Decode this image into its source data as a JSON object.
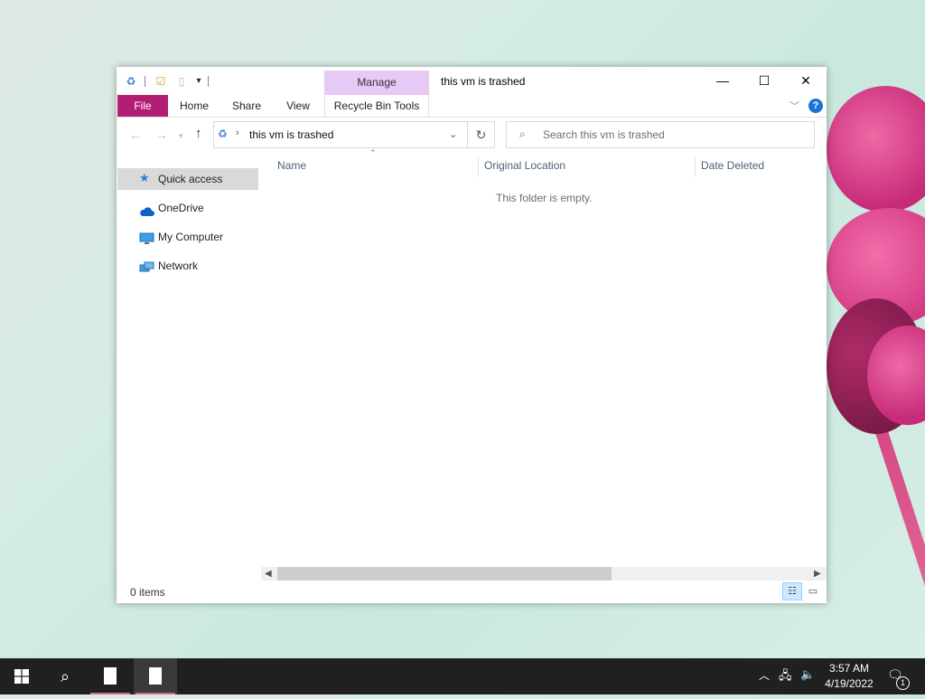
{
  "window": {
    "title": "this vm is trashed",
    "contextual_group": "Manage",
    "controls": {
      "minimize": "—",
      "maximize": "☐",
      "close": "✕"
    }
  },
  "ribbon": {
    "tabs": [
      "File",
      "Home",
      "Share",
      "View",
      "Recycle Bin Tools"
    ],
    "accent_color": "#b21e74",
    "manage_color": "#e6c9f5"
  },
  "address": {
    "path": "this vm is trashed",
    "search_placeholder": "Search this vm is trashed"
  },
  "nav_pane": {
    "items": [
      {
        "label": "Quick access",
        "icon": "star-icon",
        "selected": true
      },
      {
        "label": "OneDrive",
        "icon": "cloud-icon",
        "selected": false
      },
      {
        "label": "My Computer",
        "icon": "computer-icon",
        "selected": false
      },
      {
        "label": "Network",
        "icon": "network-icon",
        "selected": false
      }
    ]
  },
  "content": {
    "columns": [
      "Name",
      "Original Location",
      "Date Deleted"
    ],
    "empty_message": "This folder is empty."
  },
  "status": {
    "item_count": "0 items"
  },
  "taskbar": {
    "time": "3:57 AM",
    "date": "4/19/2022",
    "notification_count": "1"
  }
}
